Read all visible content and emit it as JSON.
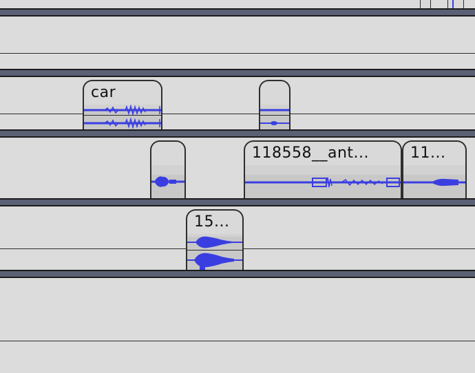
{
  "tracks": {
    "clips": [
      {
        "id": "car",
        "title": "car"
      },
      {
        "id": "blank-top",
        "title": ""
      },
      {
        "id": "blank-mid",
        "title": ""
      },
      {
        "id": "antenna",
        "title": "118558__ant..."
      },
      {
        "id": "eleven",
        "title": "11..."
      },
      {
        "id": "fifteen",
        "title": "15..."
      }
    ]
  },
  "colors": {
    "waveform": "#3a3ee0",
    "separator": "#5b6074",
    "track_bg": "#dcdcdc",
    "clip_bg": "#d9d9d9"
  }
}
